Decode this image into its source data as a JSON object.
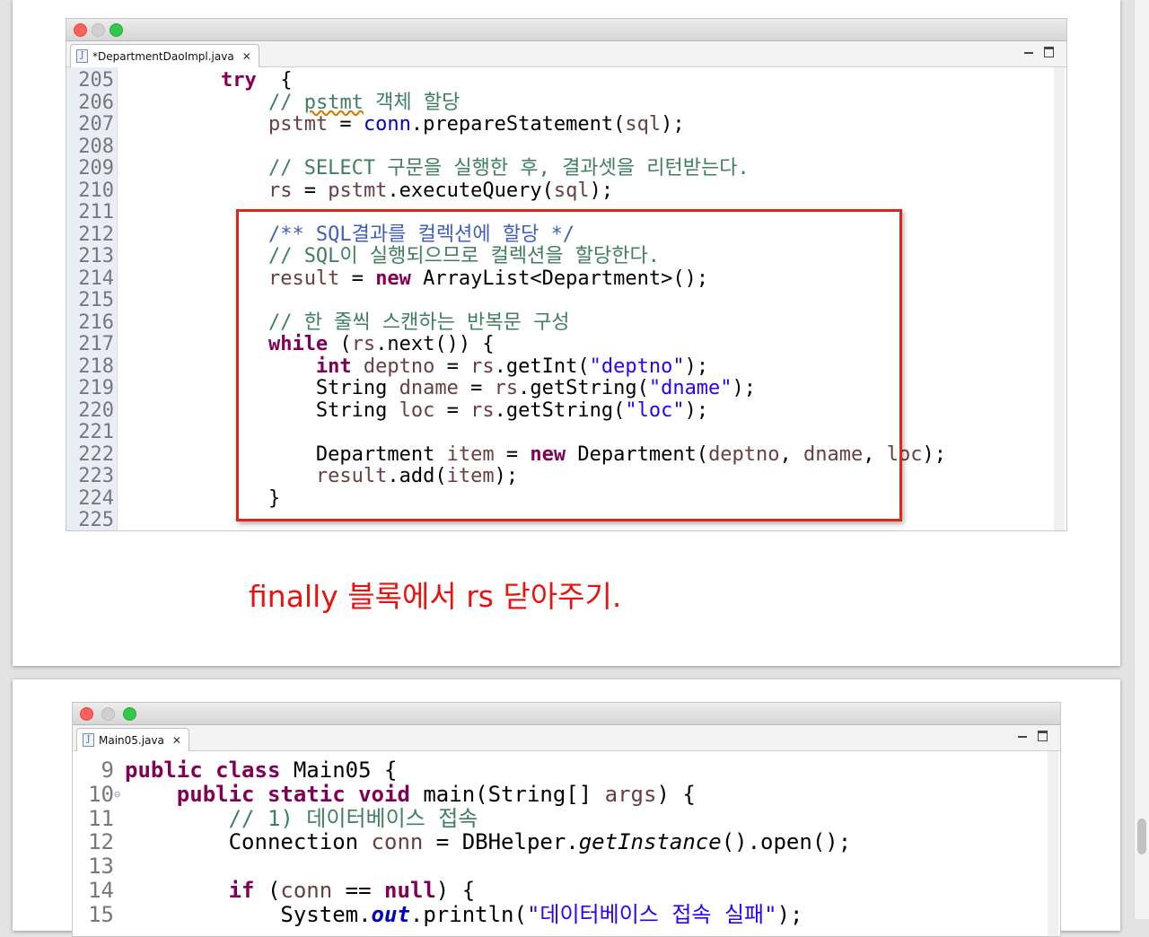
{
  "top": {
    "tab_title": "*DepartmentDaoImpl.java",
    "lines": [
      {
        "no": "205",
        "indent": 8,
        "tokens": [
          [
            "kw",
            "try"
          ],
          [
            "",
            "  {"
          ]
        ]
      },
      {
        "no": "206",
        "indent": 12,
        "tokens": [
          [
            "cm",
            "// "
          ],
          [
            "cmu",
            "pstmt"
          ],
          [
            "cm",
            " 객체 할당"
          ]
        ]
      },
      {
        "no": "207",
        "indent": 12,
        "tokens": [
          [
            "var",
            "pstmt"
          ],
          [
            "",
            " = "
          ],
          [
            "fld",
            "conn"
          ],
          [
            "",
            ".prepareStatement("
          ],
          [
            "var",
            "sql"
          ],
          [
            "",
            ");"
          ]
        ]
      },
      {
        "no": "208",
        "indent": 0,
        "tokens": []
      },
      {
        "no": "209",
        "indent": 12,
        "tokens": [
          [
            "cm",
            "// SELECT 구문을 실행한 후, 결과셋을 리턴받는다."
          ]
        ]
      },
      {
        "no": "210",
        "indent": 12,
        "tokens": [
          [
            "var",
            "rs"
          ],
          [
            "",
            " = "
          ],
          [
            "var",
            "pstmt"
          ],
          [
            "",
            ".executeQuery("
          ],
          [
            "var",
            "sql"
          ],
          [
            "",
            ");"
          ]
        ]
      },
      {
        "no": "211",
        "indent": 0,
        "tokens": []
      },
      {
        "no": "212",
        "indent": 12,
        "tokens": [
          [
            "jd",
            "/** SQL결과를 컬렉션에 할당 */"
          ]
        ]
      },
      {
        "no": "213",
        "indent": 12,
        "tokens": [
          [
            "cm",
            "// SQL이 실행되으므로 컬렉션을 할당한다."
          ]
        ]
      },
      {
        "no": "214",
        "indent": 12,
        "tokens": [
          [
            "var",
            "result"
          ],
          [
            "",
            " = "
          ],
          [
            "kw",
            "new"
          ],
          [
            "",
            " ArrayList<Department>();"
          ]
        ]
      },
      {
        "no": "215",
        "indent": 0,
        "tokens": []
      },
      {
        "no": "216",
        "indent": 12,
        "tokens": [
          [
            "cm",
            "// 한 줄씩 스캔하는 반복문 구성"
          ]
        ]
      },
      {
        "no": "217",
        "indent": 12,
        "tokens": [
          [
            "kw",
            "while"
          ],
          [
            "",
            " ("
          ],
          [
            "var",
            "rs"
          ],
          [
            "",
            ".next()) {"
          ]
        ]
      },
      {
        "no": "218",
        "indent": 16,
        "tokens": [
          [
            "kw",
            "int"
          ],
          [
            "",
            " "
          ],
          [
            "var",
            "deptno"
          ],
          [
            "",
            " = "
          ],
          [
            "var",
            "rs"
          ],
          [
            "",
            ".getInt("
          ],
          [
            "str",
            "\"deptno\""
          ],
          [
            "",
            ");"
          ]
        ]
      },
      {
        "no": "219",
        "indent": 16,
        "tokens": [
          [
            "",
            "String "
          ],
          [
            "var",
            "dname"
          ],
          [
            "",
            " = "
          ],
          [
            "var",
            "rs"
          ],
          [
            "",
            ".getString("
          ],
          [
            "str",
            "\"dname\""
          ],
          [
            "",
            ");"
          ]
        ]
      },
      {
        "no": "220",
        "indent": 16,
        "tokens": [
          [
            "",
            "String "
          ],
          [
            "var",
            "loc"
          ],
          [
            "",
            " = "
          ],
          [
            "var",
            "rs"
          ],
          [
            "",
            ".getString("
          ],
          [
            "str",
            "\"loc\""
          ],
          [
            "",
            ");"
          ]
        ]
      },
      {
        "no": "221",
        "indent": 0,
        "tokens": []
      },
      {
        "no": "222",
        "indent": 16,
        "tokens": [
          [
            "",
            "Department "
          ],
          [
            "var",
            "item"
          ],
          [
            "",
            " = "
          ],
          [
            "kw",
            "new"
          ],
          [
            "",
            " Department("
          ],
          [
            "var",
            "deptno"
          ],
          [
            "",
            ", "
          ],
          [
            "var",
            "dname"
          ],
          [
            "",
            ", "
          ],
          [
            "var",
            "loc"
          ],
          [
            "",
            ");"
          ]
        ]
      },
      {
        "no": "223",
        "indent": 16,
        "tokens": [
          [
            "var",
            "result"
          ],
          [
            "",
            ".add("
          ],
          [
            "var",
            "item"
          ],
          [
            "",
            ");"
          ]
        ]
      },
      {
        "no": "224",
        "indent": 12,
        "tokens": [
          [
            "",
            "}"
          ]
        ]
      },
      {
        "no": "225",
        "indent": 0,
        "tokens": []
      }
    ]
  },
  "caption": "finally 블록에서 rs 닫아주기.",
  "bottom": {
    "tab_title": "Main05.java",
    "lines": [
      {
        "no": "9",
        "indent": 0,
        "tokens": [
          [
            "kw",
            "public"
          ],
          [
            "",
            " "
          ],
          [
            "kw",
            "class"
          ],
          [
            "",
            " Main05 {"
          ]
        ]
      },
      {
        "no": "10",
        "fold": true,
        "indent": 4,
        "tokens": [
          [
            "kw",
            "public"
          ],
          [
            "",
            " "
          ],
          [
            "kw",
            "static"
          ],
          [
            "",
            " "
          ],
          [
            "kw",
            "void"
          ],
          [
            "",
            " main(String[] "
          ],
          [
            "var",
            "args"
          ],
          [
            "",
            ") {"
          ]
        ]
      },
      {
        "no": "11",
        "indent": 8,
        "tokens": [
          [
            "cm",
            "// 1) 데이터베이스 접속"
          ]
        ]
      },
      {
        "no": "12",
        "indent": 8,
        "tokens": [
          [
            "",
            "Connection "
          ],
          [
            "var",
            "conn"
          ],
          [
            "",
            " = DBHelper."
          ],
          [
            "it",
            "getInstance"
          ],
          [
            "",
            "().open();"
          ]
        ]
      },
      {
        "no": "13",
        "indent": 0,
        "tokens": []
      },
      {
        "no": "14",
        "indent": 8,
        "tokens": [
          [
            "kw",
            "if"
          ],
          [
            "",
            " ("
          ],
          [
            "var",
            "conn"
          ],
          [
            "",
            " == "
          ],
          [
            "kw",
            "null"
          ],
          [
            "",
            ") {"
          ]
        ]
      },
      {
        "no": "15",
        "indent": 12,
        "tokens": [
          [
            "",
            "System."
          ],
          [
            "fldit",
            "out"
          ],
          [
            "",
            ".println("
          ],
          [
            "str",
            "\"데이터베이스 접속 실패\""
          ],
          [
            "",
            ");"
          ]
        ]
      }
    ]
  }
}
